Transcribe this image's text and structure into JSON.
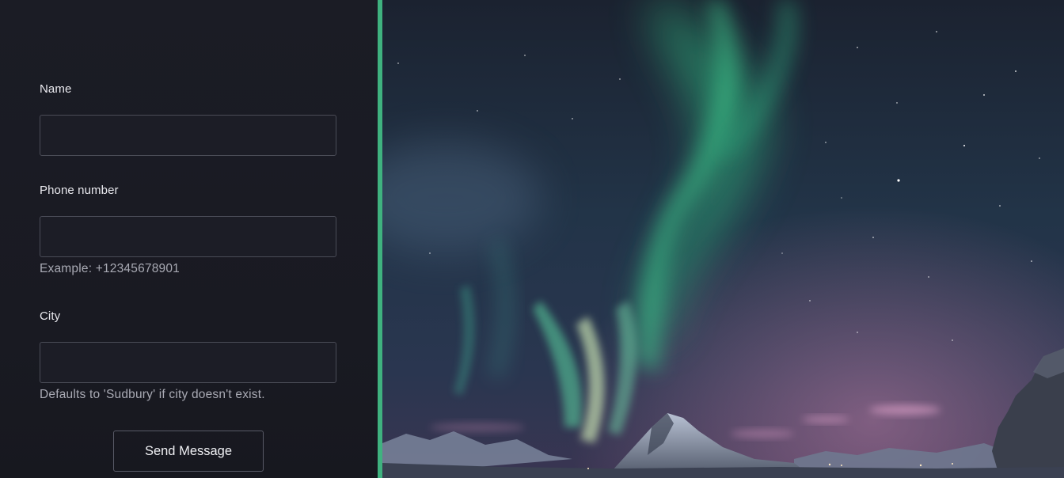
{
  "form": {
    "name_label": "Name",
    "name_value": "",
    "phone_label": "Phone number",
    "phone_value": "",
    "phone_hint": "Example: +12345678901",
    "city_label": "City",
    "city_value": "",
    "city_hint": "Defaults to 'Sudbury' if city doesn't exist.",
    "submit_label": "Send Message"
  },
  "theme": {
    "panel_background": "#1a1b23",
    "accent": "#3fb27f",
    "input_border": "#4a4c57"
  }
}
